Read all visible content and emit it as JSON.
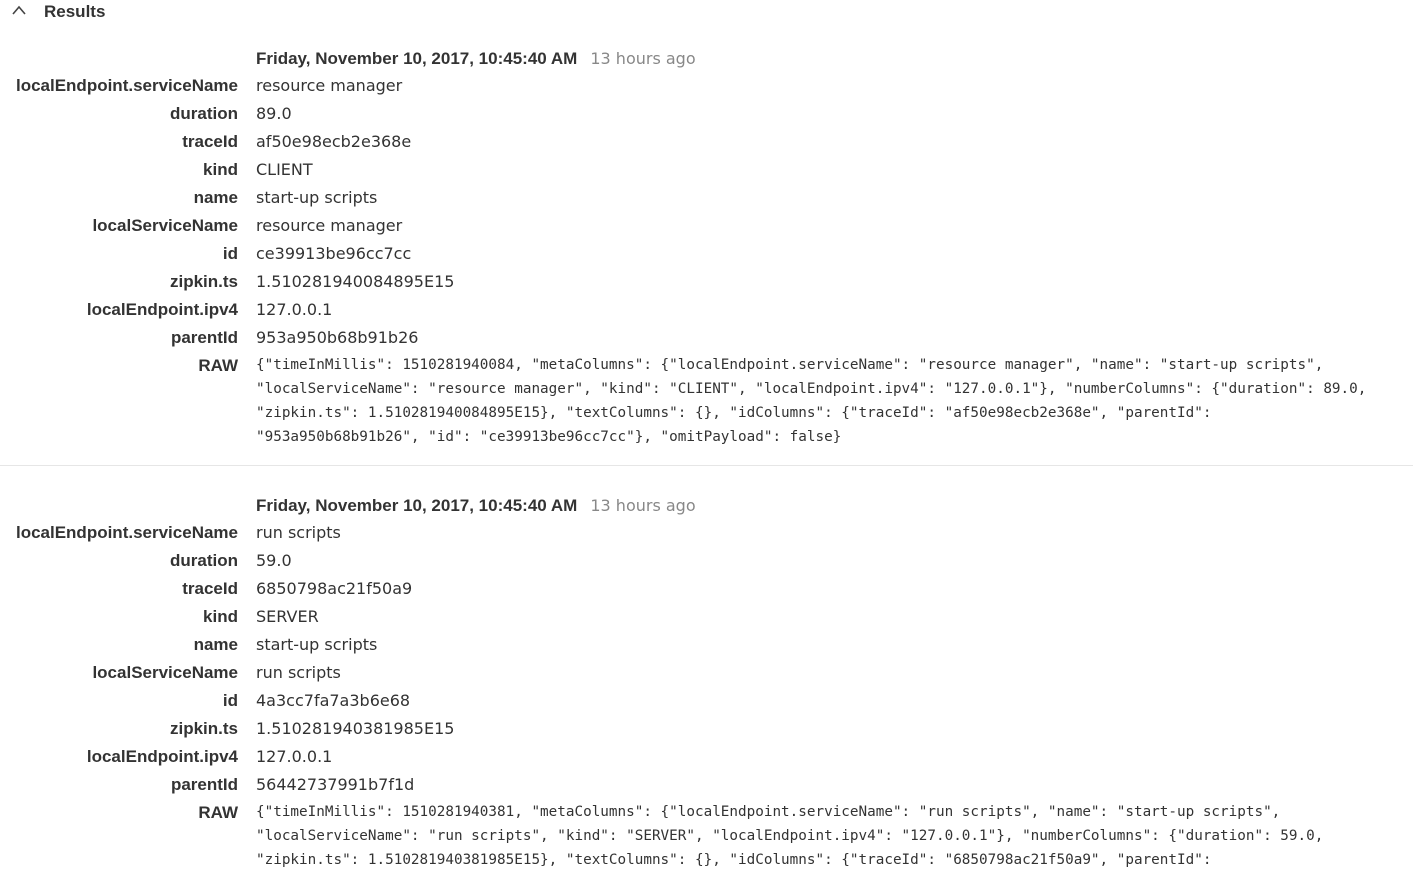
{
  "results": {
    "title": "Results"
  },
  "entries": [
    {
      "timestamp": "Friday, November 10, 2017, 10:45:40 AM",
      "relative": "13 hours ago",
      "fields": [
        {
          "label": "localEndpoint.serviceName",
          "value": "resource manager"
        },
        {
          "label": "duration",
          "value": "89.0"
        },
        {
          "label": "traceId",
          "value": "af50e98ecb2e368e"
        },
        {
          "label": "kind",
          "value": "CLIENT"
        },
        {
          "label": "name",
          "value": "start-up scripts"
        },
        {
          "label": "localServiceName",
          "value": "resource manager"
        },
        {
          "label": "id",
          "value": "ce39913be96cc7cc"
        },
        {
          "label": "zipkin.ts",
          "value": "1.510281940084895E15"
        },
        {
          "label": "localEndpoint.ipv4",
          "value": "127.0.0.1"
        },
        {
          "label": "parentId",
          "value": "953a950b68b91b26"
        }
      ],
      "raw_label": "RAW",
      "raw": "{\"timeInMillis\": 1510281940084, \"metaColumns\": {\"localEndpoint.serviceName\": \"resource manager\", \"name\": \"start-up scripts\", \"localServiceName\": \"resource manager\", \"kind\": \"CLIENT\", \"localEndpoint.ipv4\": \"127.0.0.1\"}, \"numberColumns\": {\"duration\": 89.0, \"zipkin.ts\": 1.510281940084895E15}, \"textColumns\": {}, \"idColumns\": {\"traceId\": \"af50e98ecb2e368e\", \"parentId\": \"953a950b68b91b26\", \"id\": \"ce39913be96cc7cc\"}, \"omitPayload\": false}"
    },
    {
      "timestamp": "Friday, November 10, 2017, 10:45:40 AM",
      "relative": "13 hours ago",
      "fields": [
        {
          "label": "localEndpoint.serviceName",
          "value": "run scripts"
        },
        {
          "label": "duration",
          "value": "59.0"
        },
        {
          "label": "traceId",
          "value": "6850798ac21f50a9"
        },
        {
          "label": "kind",
          "value": "SERVER"
        },
        {
          "label": "name",
          "value": "start-up scripts"
        },
        {
          "label": "localServiceName",
          "value": "run scripts"
        },
        {
          "label": "id",
          "value": "4a3cc7fa7a3b6e68"
        },
        {
          "label": "zipkin.ts",
          "value": "1.510281940381985E15"
        },
        {
          "label": "localEndpoint.ipv4",
          "value": "127.0.0.1"
        },
        {
          "label": "parentId",
          "value": "56442737991b7f1d"
        }
      ],
      "raw_label": "RAW",
      "raw": "{\"timeInMillis\": 1510281940381, \"metaColumns\": {\"localEndpoint.serviceName\": \"run scripts\", \"name\": \"start-up scripts\", \"localServiceName\": \"run scripts\", \"kind\": \"SERVER\", \"localEndpoint.ipv4\": \"127.0.0.1\"}, \"numberColumns\": {\"duration\": 59.0, \"zipkin.ts\": 1.510281940381985E15}, \"textColumns\": {}, \"idColumns\": {\"traceId\": \"6850798ac21f50a9\", \"parentId\":"
    }
  ]
}
